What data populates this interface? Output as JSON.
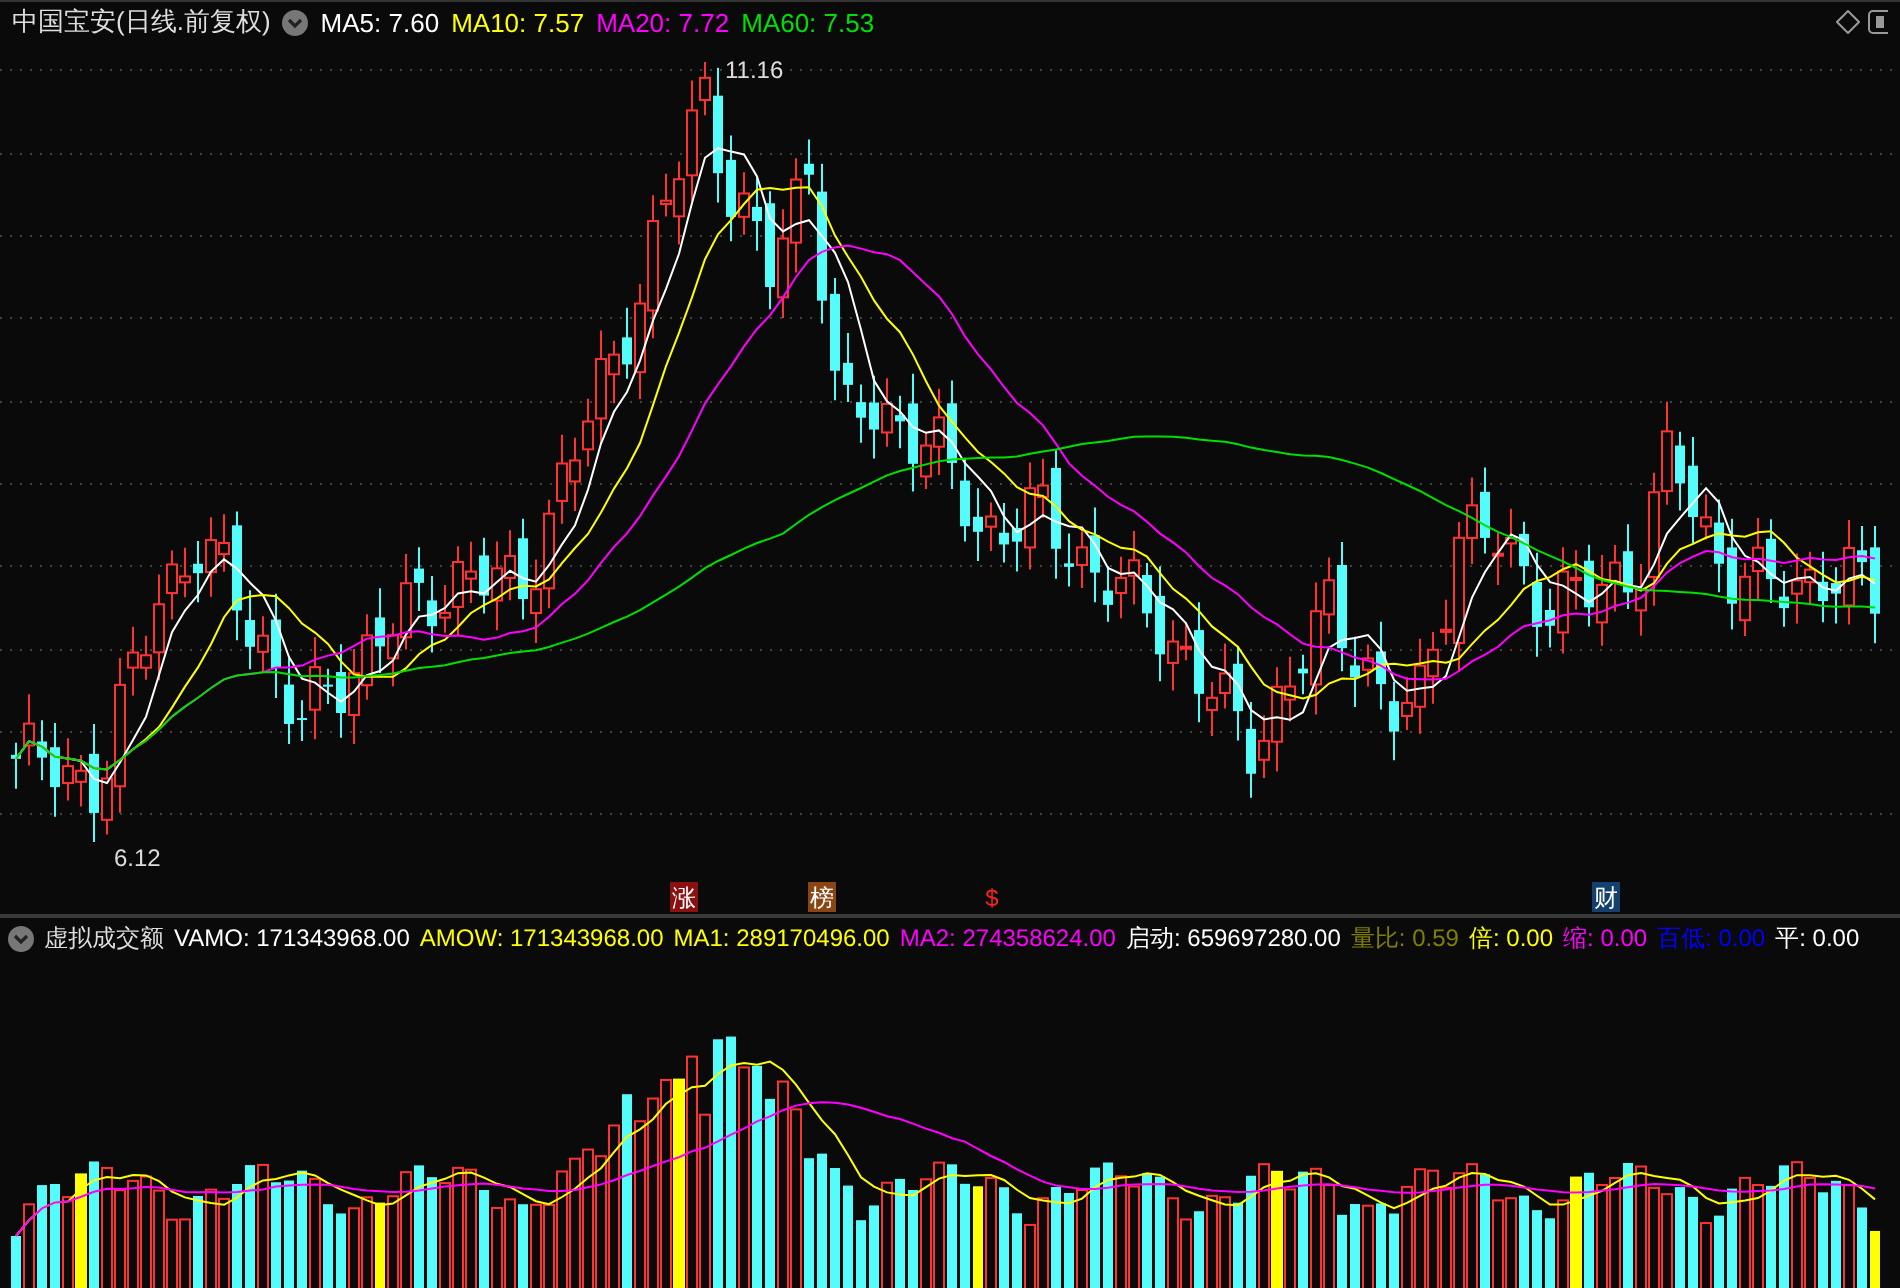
{
  "chart_header": {
    "title": "中国宝安(日线.前复权)",
    "ma_readings": [
      {
        "label": "MA5:",
        "value": "7.60",
        "color": "#ffffff"
      },
      {
        "label": "MA10:",
        "value": "7.57",
        "color": "#ffff00"
      },
      {
        "label": "MA20:",
        "value": "7.72",
        "color": "#ff00ff"
      },
      {
        "label": "MA60:",
        "value": "7.53",
        "color": "#00e000"
      }
    ]
  },
  "price_labels": {
    "high": "11.16",
    "low": "6.12"
  },
  "event_markers": [
    {
      "text": "涨",
      "color": "#8b1010"
    },
    {
      "text": "榜",
      "color": "#8b4513"
    },
    {
      "text": "$",
      "color": "#ff2020"
    },
    {
      "text": "财",
      "color": "#14406e"
    }
  ],
  "indicator_header": {
    "name": "虚拟成交额",
    "readings": [
      {
        "label": "VAMO:",
        "value": "171343968.00",
        "color": "#ffffff"
      },
      {
        "label": "AMOW:",
        "value": "171343968.00",
        "color": "#ffff00"
      },
      {
        "label": "MA1:",
        "value": "289170496.00",
        "color": "#ffff00"
      },
      {
        "label": "MA2:",
        "value": "274358624.00",
        "color": "#ff00ff"
      },
      {
        "label": "启动:",
        "value": "659697280.00",
        "color": "#ffffff"
      },
      {
        "label": "量比:",
        "value": "0.59",
        "color": "#808000"
      },
      {
        "label": "倍:",
        "value": "0.00",
        "color": "#ffff00"
      },
      {
        "label": "缩:",
        "value": "0.00",
        "color": "#ff00ff"
      },
      {
        "label": "百低:",
        "value": "0.00",
        "color": "#0000ff"
      },
      {
        "label": "平:",
        "value": "0.00",
        "color": "#ffffff"
      }
    ]
  }
}
